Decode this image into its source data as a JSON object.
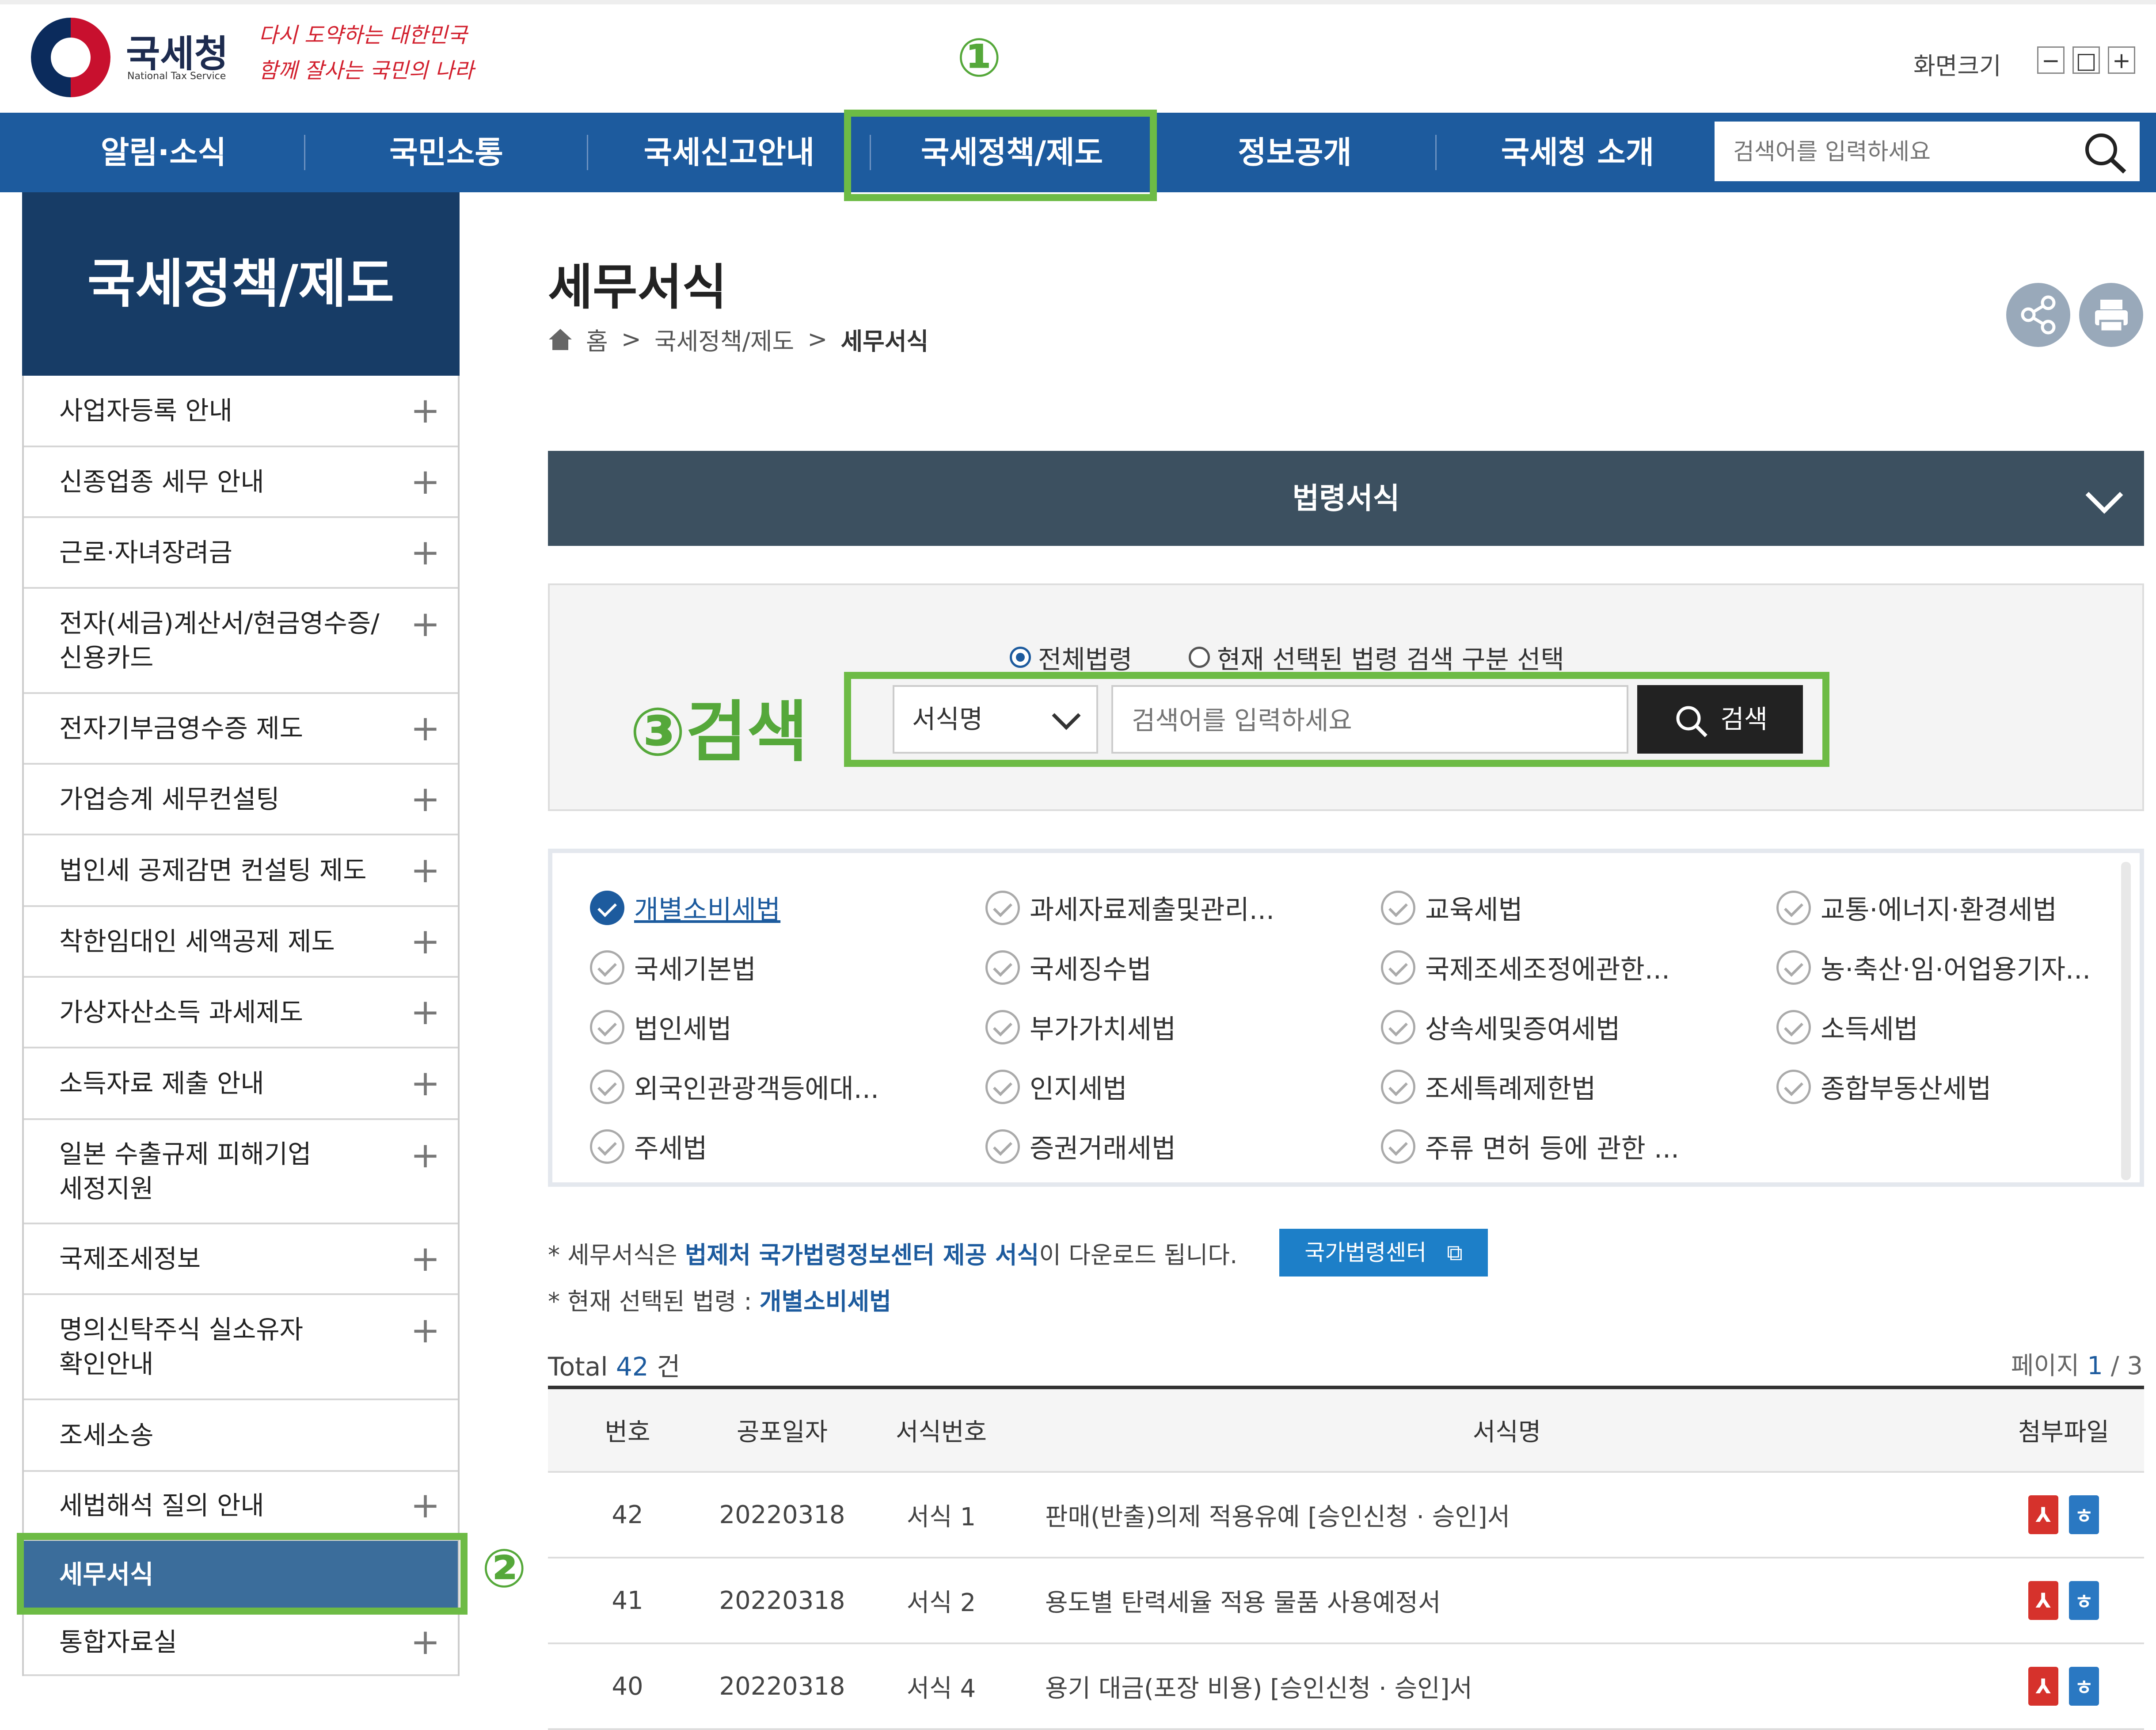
{
  "header": {
    "logo_text": "국세청",
    "logo_sub": "National Tax Service",
    "slogan_line1": "다시 도약하는 대한민국",
    "slogan_line2": "함께 잘사는 국민의 나라",
    "font_size_label": "화면크기",
    "fs_minus": "−",
    "fs_reset": "□",
    "fs_plus": "+"
  },
  "nav": {
    "items": [
      "알림·소식",
      "국민소통",
      "국세신고안내",
      "국세정책/제도",
      "정보공개",
      "국세청 소개"
    ],
    "search_placeholder": "검색어를 입력하세요"
  },
  "annotations": {
    "one": "①",
    "two": "②",
    "three": "③검색"
  },
  "sidebar": {
    "title": "국세정책/제도",
    "items": [
      {
        "label": "사업자등록 안내",
        "plus": "+"
      },
      {
        "label": "신종업종 세무 안내",
        "plus": "+"
      },
      {
        "label": "근로·자녀장려금",
        "plus": "+"
      },
      {
        "label": "전자(세금)계산서/현금영수증/\n신용카드",
        "plus": "+"
      },
      {
        "label": "전자기부금영수증 제도",
        "plus": "+"
      },
      {
        "label": "가업승계 세무컨설팅",
        "plus": "+"
      },
      {
        "label": "법인세 공제감면 컨설팅 제도",
        "plus": "+"
      },
      {
        "label": "착한임대인 세액공제 제도",
        "plus": "+"
      },
      {
        "label": "가상자산소득 과세제도",
        "plus": "+"
      },
      {
        "label": "소득자료 제출 안내",
        "plus": "+"
      },
      {
        "label": "일본 수출규제 피해기업\n세정지원",
        "plus": "+"
      },
      {
        "label": "국제조세정보",
        "plus": "+"
      },
      {
        "label": "명의신탁주식 실소유자\n확인안내",
        "plus": "+"
      },
      {
        "label": "조세소송",
        "plus": ""
      },
      {
        "label": "세법해석 질의 안내",
        "plus": "+"
      },
      {
        "label": "세무서식",
        "plus": ""
      },
      {
        "label": "통합자료실",
        "plus": "+"
      }
    ]
  },
  "content": {
    "title": "세무서식",
    "breadcrumb": [
      "홈",
      "국세정책/제도",
      "세무서식"
    ],
    "breadcrumb_sep": ">",
    "law_bar": "법령서식",
    "radio_all": "전체법령",
    "radio_selected": "현재 선택된 법령 검색 구분 선택",
    "select_value": "서식명",
    "search_placeholder": "검색어를 입력하세요",
    "search_button": "검색",
    "laws": [
      "개별소비세법",
      "과세자료제출및관리...",
      "교육세법",
      "교통·에너지·환경세법",
      "국세기본법",
      "국세징수법",
      "국제조세조정에관한...",
      "농·축산·임·어업용기자...",
      "법인세법",
      "부가가치세법",
      "상속세및증여세법",
      "소득세법",
      "외국인관광객등에대...",
      "인지세법",
      "조세특례제한법",
      "종합부동산세법",
      "주세법",
      "증권거래세법",
      "주류 면허 등에 관한 ..."
    ],
    "note1_pre": "* 세무서식은 ",
    "note1_bold": "법제처 국가법령정보센터 제공 서식",
    "note1_post": "이 다운로드 됩니다.",
    "nlc_button": "국가법령센터",
    "note2_pre": "* 현재 선택된 법령 : ",
    "note2_bold": "개별소비세법",
    "total_pre": "Total ",
    "total_count": "42",
    "total_post": " 건",
    "page_label": "페이지 ",
    "page_current": "1",
    "page_sep": " / ",
    "page_total": "3"
  },
  "table": {
    "headers": [
      "번호",
      "공포일자",
      "서식번호",
      "서식명",
      "첨부파일"
    ],
    "rows": [
      {
        "no": "42",
        "date": "20220318",
        "form_no": "서식 1",
        "name": "판매(반출)의제 적용유예 [승인신청 · 승인]서"
      },
      {
        "no": "41",
        "date": "20220318",
        "form_no": "서식 2",
        "name": "용도별 탄력세율 적용 물품 사용예정서"
      },
      {
        "no": "40",
        "date": "20220318",
        "form_no": "서식 4",
        "name": "용기 대금(포장 비용) [승인신청 · 승인]서"
      }
    ]
  },
  "colors": {
    "nav_bg": "#1d5b9e",
    "sidebar_head": "#173c66",
    "law_bar": "#3c5060",
    "annotation": "#6dbb45"
  }
}
